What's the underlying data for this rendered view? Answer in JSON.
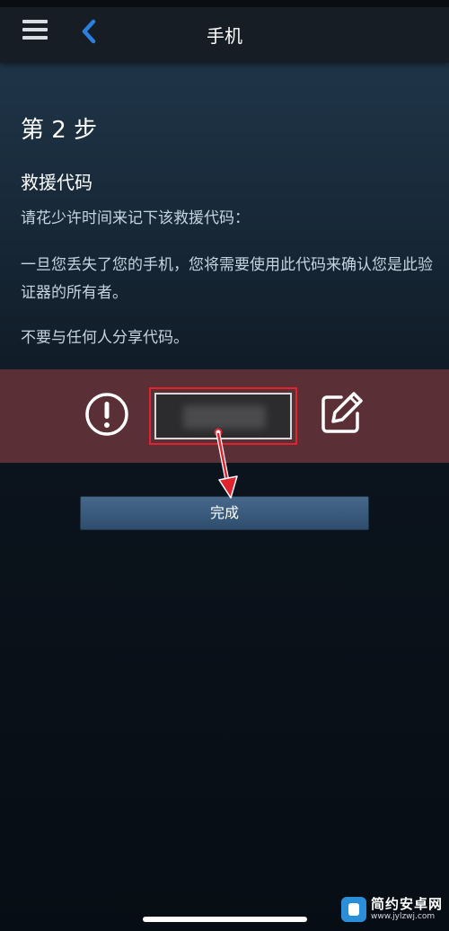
{
  "header": {
    "title": "手机"
  },
  "content": {
    "step": "第 2 步",
    "section_title": "救援代码",
    "paragraphs": [
      "请花少许时间来记下该救援代码：",
      "一旦您丢失了您的手机，您将需要使用此代码来确认您是此验证器的所有者。",
      "不要与任何人分享代码。"
    ]
  },
  "actions": {
    "done_label": "完成"
  },
  "watermark": {
    "name": "简约安卓网",
    "url": "www.jylzwj.com"
  },
  "colors": {
    "topbar": "#171d25",
    "accent_blue": "#2b7fe0",
    "code_band": "#5a2f35",
    "highlight_red": "#e0232e",
    "button": "#3a5b7d",
    "body_text": "#c6d4df"
  },
  "icons": {
    "menu": "hamburger-menu-icon",
    "back": "chevron-left-icon",
    "alert": "exclamation-circle-icon",
    "edit": "pencil-square-icon",
    "annotation_arrow": "red-arrow-icon"
  }
}
